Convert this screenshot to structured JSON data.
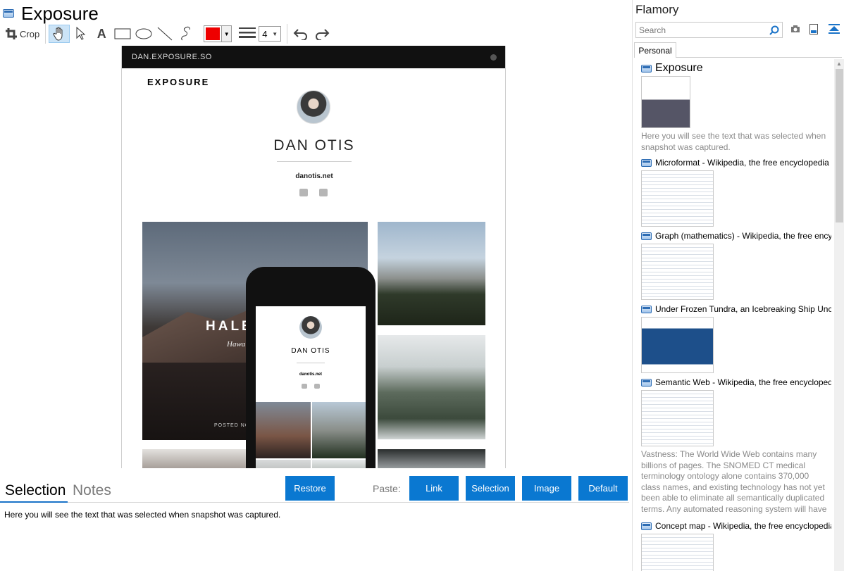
{
  "app": {
    "title": "Exposure"
  },
  "toolbar": {
    "crop_label": "Crop",
    "color": "#ee0000",
    "line_width": "4"
  },
  "snapshot": {
    "url": "DAN.EXPOSURE.SO",
    "brand": "EXPOSURE",
    "name": "DAN OTIS",
    "profile_url": "danotis.net",
    "hero_title": "HALE",
    "hero_sub": "Hawa",
    "hero_posted": "POSTED NOV",
    "phone_name": "DAN OTIS",
    "phone_url": "danotis.net"
  },
  "tabs": {
    "selection": "Selection",
    "notes": "Notes"
  },
  "actions": {
    "restore": "Restore",
    "paste_label": "Paste:",
    "link": "Link",
    "selection": "Selection",
    "image": "Image",
    "default": "Default"
  },
  "selection_text": "Here you will see the text that was selected when snapshot was captured.",
  "flamory": {
    "title": "Flamory",
    "search_placeholder": "Search",
    "tab": "Personal",
    "items": [
      {
        "title": "Exposure",
        "desc": "Here you will see the text that was selected when snapshot was captured."
      },
      {
        "title": "Microformat - Wikipedia, the free encyclopedia",
        "desc": ""
      },
      {
        "title": "Graph (mathematics) - Wikipedia, the free encyclopedia",
        "desc": ""
      },
      {
        "title": "Under Frozen Tundra, an Icebreaking Ship Uncovers",
        "desc": ""
      },
      {
        "title": "Semantic Web - Wikipedia, the free encyclopedia",
        "desc": "Vastness: The World Wide Web contains many billions of pages. The SNOMED CT medical terminology ontology alone contains 370,000 class names, and existing technology has not yet been able to eliminate all semantically duplicated terms. Any automated reasoning system will have to deal with truly huge inputs."
      },
      {
        "title": "Concept map - Wikipedia, the free encyclopedia",
        "desc": ""
      }
    ]
  },
  "colors": {
    "accent": "#0a78d1",
    "tab_underline": "#1a73c8"
  }
}
